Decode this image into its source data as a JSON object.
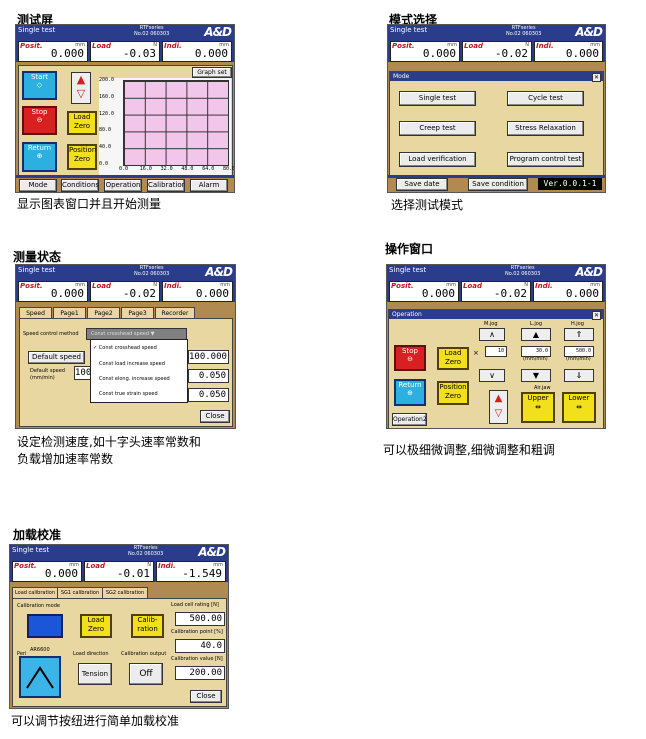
{
  "headings": {
    "p1": "测试屏",
    "p2": "模式选择",
    "p3": "测量状态",
    "p4": "操作窗口",
    "p5": "加载校准"
  },
  "captions": {
    "p1": "显示图表窗口并且开始测量",
    "p2": "选择测试模式",
    "p3_line1": "设定检测速度,如十字头速率常数和",
    "p3_line2": "负载增加速率常数",
    "p4": "可以极细微调整,细微调整和粗调",
    "p5": "可以调节按纽进行简单加载校准"
  },
  "common": {
    "title": "Single test",
    "model_line1": "RTFseries",
    "model_line2": "No.02 060303",
    "logo": "A&D",
    "posit_label": "Posit.",
    "load_label": "Load",
    "indi_label": "Indi.",
    "unit_mm": "mm",
    "unit_n": "N",
    "unit_mm2": "mm"
  },
  "s1": {
    "posit": "0.000",
    "load": "-0.03",
    "indi": "0.000",
    "start": "Start",
    "stop": "Stop",
    "return": "Return",
    "load_zero": "Load Zero",
    "position_zero": "Position Zero",
    "graph_set": "Graph set",
    "y_ticks": [
      "200.0",
      "160.0",
      "120.0",
      "80.0",
      "40.0",
      "0.0"
    ],
    "x_ticks": [
      "0.0",
      "16.0",
      "32.0",
      "48.0",
      "64.0",
      "80.0"
    ],
    "tabs": [
      "Mode",
      "Conditions",
      "Operation",
      "Calibration",
      "Alarm"
    ]
  },
  "s2": {
    "posit": "0.000",
    "load": "-0.02",
    "indi": "0.000",
    "mode_title": "Mode",
    "buttons": [
      "Single test",
      "Cycle test",
      "Creep test",
      "Stress Relaxation",
      "Load verification",
      "Program control test"
    ],
    "save_date": "Save date",
    "save_condition": "Save condition",
    "version": "Ver.0.0.1-1"
  },
  "s3": {
    "posit": "0.000",
    "load": "-0.02",
    "indi": "0.000",
    "tabs": [
      "Speed",
      "Page1",
      "Page2",
      "Page3",
      "Recorder"
    ],
    "control_method": "Speed control method",
    "selected_method": "Const crosshead speed",
    "default_speed": "Default speed",
    "default_speed2": "Default speed (mm/min)",
    "field_partial": "100",
    "options": [
      "Const crosshead speed",
      "Const load increase speed",
      "Const elong. increase speed",
      "Const true strain speed"
    ],
    "values": [
      "100.000",
      "0.050",
      "0.050"
    ],
    "close": "Close"
  },
  "s4": {
    "posit": "0.000",
    "load": "-0.02",
    "indi": "0.000",
    "op_title": "Operation",
    "stop": "Stop",
    "return": "Return",
    "load_zero": "Load Zero",
    "position_zero": "Position Zero",
    "m_jog": "M.jog",
    "l_jog": "L.jog",
    "h_jog": "H.jog",
    "mult": "×",
    "m_value": "10",
    "l_value": "30.0",
    "h_value": "500.0",
    "unit": "(mm/min)",
    "air_jaw": "Air.jaw",
    "upper": "Upper",
    "lower": "Lower",
    "operation2": "Operation2"
  },
  "s5": {
    "posit": "0.000",
    "load": "-0.01",
    "indi": "-1.549",
    "tabs": [
      "Load calibration",
      "SG1 calibration",
      "SG2 calibration"
    ],
    "calibration_mode": "Calibration mode",
    "load_zero": "Load Zero",
    "calibration": "Calib-ration",
    "load_cell_rating": "Load cell rating [N]",
    "rating_value": "500.00",
    "calibration_point": "Calibration point [%]",
    "point_value": "40.0",
    "calibration_value": "Calibration value [N]",
    "cal_value": "200.00",
    "peri": "Peri",
    "ar6600": "AR6600",
    "load_direction": "Load direction",
    "tension": "Tension",
    "calibration_output": "Calibration output",
    "off": "Off",
    "close": "Close"
  }
}
